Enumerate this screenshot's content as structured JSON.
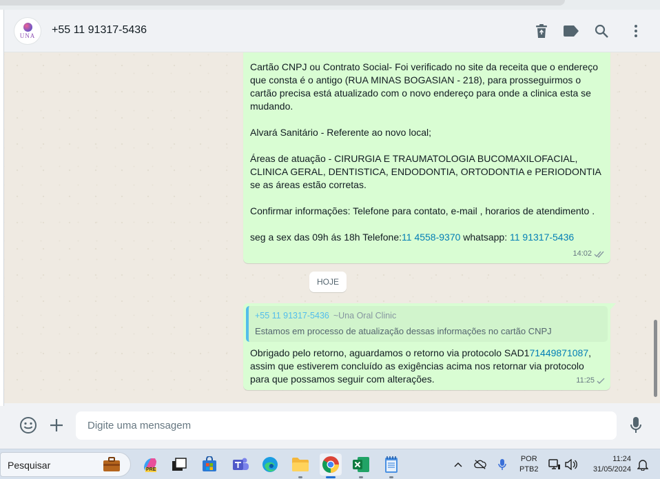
{
  "header": {
    "logo_text": "UNA",
    "contact_name": "+55 11 91317-5436",
    "icons": [
      "delete-icon",
      "label-icon",
      "search-icon",
      "menu-icon"
    ]
  },
  "messages": {
    "m1": {
      "p1": "Cartão CNPJ ou Contrato Social- Foi verificado no site da receita que o endereço que consta é o antigo (RUA MINAS BOGASIAN - 218), para prosseguirmos o cartão precisa está atualizado com o novo endereço para onde a clinica esta se mudando.",
      "p2": "Alvará Sanitário - Referente ao novo local;",
      "p3": "Áreas de atuação - CIRURGIA E TRAUMATOLOGIA BUCOMAXILOFACIAL, CLINICA GERAL, DENTISTICA, ENDODONTIA, ORTODONTIA e PERIODONTIA se as áreas estão corretas.",
      "p4": "Confirmar informações: Telefone para contato, e-mail , horarios de atendimento .",
      "p5_prefix": "seg a sex das 09h ás 18h Telefone:",
      "p5_phone": "11 4558-9370",
      "p5_mid": " whatsapp: ",
      "p5_whatsapp": "11 91317-5436",
      "time": "14:02"
    },
    "date_divider": "HOJE",
    "m2": {
      "quote_number": "+55 11 91317-5436",
      "quote_name": "~Una Oral Clinic",
      "quote_text": "Estamos em processo de atualização dessas informações no cartão CNPJ",
      "body_prefix": "Obrigado pelo retorno, aguardamos o retorno via protocolo SAD1",
      "body_link": "71449871087",
      "body_suffix": ", assim que estiverem concluído as exigências acima nos retornar via protocolo para que possamos seguir com alterações.",
      "time": "11:25"
    }
  },
  "composer": {
    "placeholder": "Digite uma mensagem"
  },
  "taskbar": {
    "search_label": "Pesquisar",
    "lang_line1": "POR",
    "lang_line2": "PTB2",
    "time": "11:24",
    "date": "31/05/2024",
    "copilot_badge": "PRE"
  },
  "colors": {
    "outgoing_bubble": "#d9fdd3",
    "link": "#027eb5",
    "quote_accent": "#53bdeb",
    "chat_bg": "#efeae2"
  }
}
